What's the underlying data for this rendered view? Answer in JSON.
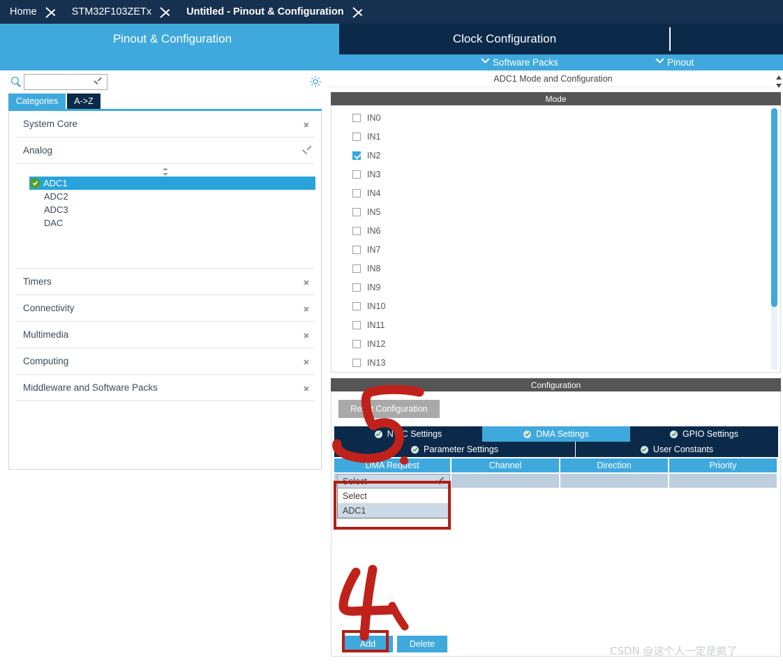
{
  "breadcrumb": {
    "items": [
      {
        "label": "Home",
        "active": false
      },
      {
        "label": "STM32F103ZETx",
        "active": false
      },
      {
        "label": "Untitled - Pinout & Configuration",
        "active": true
      }
    ]
  },
  "tabs": {
    "pinout": "Pinout & Configuration",
    "clock": "Clock Configuration",
    "extra": ""
  },
  "subbar": {
    "software_packs": "Software Packs",
    "pinout": "Pinout"
  },
  "left": {
    "search": {
      "value": "",
      "placeholder": ""
    },
    "view_tabs": {
      "categories": "Categories",
      "az": "A->Z"
    },
    "categories": [
      {
        "label": "System Core",
        "expanded": false
      },
      {
        "label": "Analog",
        "expanded": true
      },
      {
        "label": "Timers",
        "expanded": false
      },
      {
        "label": "Connectivity",
        "expanded": false
      },
      {
        "label": "Multimedia",
        "expanded": false
      },
      {
        "label": "Computing",
        "expanded": false
      },
      {
        "label": "Middleware and Software Packs",
        "expanded": false
      }
    ],
    "analog_items": [
      {
        "label": "ADC1",
        "selected": true,
        "configured": true
      },
      {
        "label": "ADC2",
        "selected": false,
        "configured": false
      },
      {
        "label": "ADC3",
        "selected": false,
        "configured": false
      },
      {
        "label": "DAC",
        "selected": false,
        "configured": false
      }
    ]
  },
  "right": {
    "peripheral_title": "ADC1 Mode and Configuration",
    "mode_header": "Mode",
    "mode_channels": [
      {
        "label": "IN0",
        "checked": false
      },
      {
        "label": "IN1",
        "checked": false
      },
      {
        "label": "IN2",
        "checked": true
      },
      {
        "label": "IN3",
        "checked": false
      },
      {
        "label": "IN4",
        "checked": false
      },
      {
        "label": "IN5",
        "checked": false
      },
      {
        "label": "IN6",
        "checked": false
      },
      {
        "label": "IN7",
        "checked": false
      },
      {
        "label": "IN8",
        "checked": false
      },
      {
        "label": "IN9",
        "checked": false
      },
      {
        "label": "IN10",
        "checked": false
      },
      {
        "label": "IN11",
        "checked": false
      },
      {
        "label": "IN12",
        "checked": false
      },
      {
        "label": "IN13",
        "checked": false
      }
    ],
    "configuration_header": "Configuration",
    "reset_button": "Reset Configuration",
    "config_tabs_row1": [
      {
        "label": "NVIC Settings",
        "active": false
      },
      {
        "label": "DMA Settings",
        "active": true
      },
      {
        "label": "GPIO Settings",
        "active": false
      }
    ],
    "config_tabs_row2": [
      {
        "label": "Parameter Settings",
        "active": false
      },
      {
        "label": "User Constants",
        "active": false
      }
    ],
    "dma_table": {
      "columns": [
        "DMA Request",
        "Channel",
        "Direction",
        "Priority"
      ],
      "rows": [
        {
          "request": "",
          "channel": "",
          "direction": "",
          "priority": ""
        }
      ]
    },
    "dma_dropdown": {
      "selected": "Select",
      "open": true,
      "options": [
        {
          "label": "Select",
          "highlighted": false
        },
        {
          "label": "ADC1",
          "highlighted": true
        }
      ]
    },
    "buttons": {
      "add": "Add",
      "delete": "Delete"
    }
  },
  "annotations": [
    {
      "name": "step-5",
      "text": "5"
    },
    {
      "name": "step-4",
      "text": "4"
    }
  ],
  "watermark": "CSDN @这个人一定是疯了",
  "colors": {
    "accent": "#3fa9dd",
    "dark_navy": "#0b2a49",
    "breadcrumb": "#16304f",
    "section_header": "#555555",
    "annotation_red": "#b21e14",
    "ok_green": "#4fa12b"
  }
}
